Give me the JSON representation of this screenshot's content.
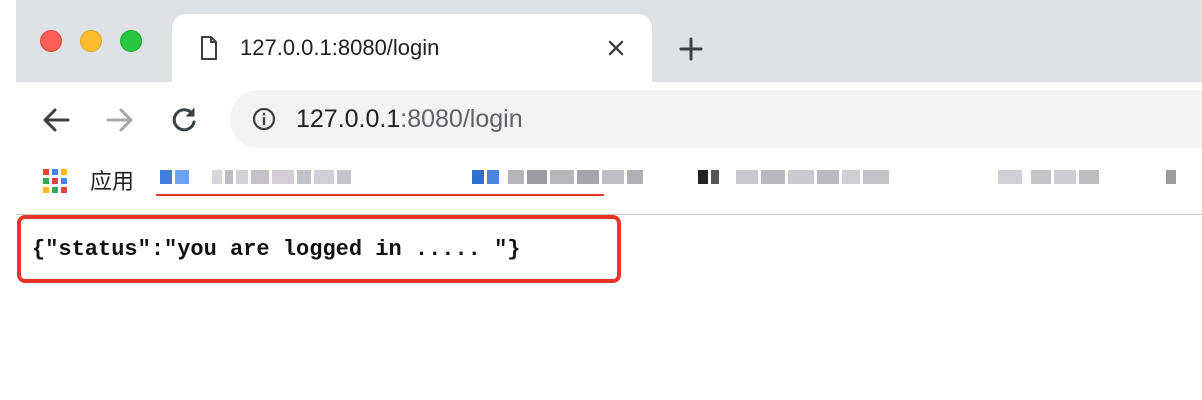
{
  "window": {
    "traffic_lights": [
      "close",
      "minimize",
      "maximize"
    ]
  },
  "tab": {
    "title": "127.0.0.1:8080/login",
    "icon": "page-icon",
    "close_icon": "close-icon",
    "new_tab_icon": "plus-icon"
  },
  "toolbar": {
    "back_icon": "arrow-left-icon",
    "forward_icon": "arrow-right-icon",
    "reload_icon": "reload-icon",
    "info_icon": "info-icon",
    "url_host": "127.0.0.1",
    "url_rest": ":8080/login"
  },
  "bookmarks": {
    "apps_label": "应用",
    "apps_icon": "apps-grid-icon"
  },
  "page": {
    "body_text": "{\"status\":\"you are logged in ..... \"}"
  },
  "colors": {
    "highlight": "#e8352c",
    "tabstrip_bg": "#dee1e6",
    "omnibox_bg": "#f1f3f4"
  }
}
